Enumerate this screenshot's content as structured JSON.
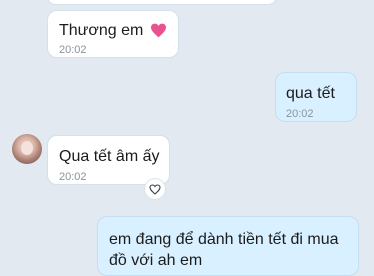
{
  "messages": [
    {
      "text": "",
      "time": ""
    },
    {
      "text": "Thương em",
      "time": "20:02",
      "emoji": "heart"
    },
    {
      "text": "qua tết",
      "time": "20:02"
    },
    {
      "text": "Qua tết âm ấy",
      "time": "20:02"
    },
    {
      "text": "em đang để dành tiền tết đi mua\nđồ với ah em",
      "time": ""
    }
  ],
  "icons": {
    "inline_emoji": "heart-icon",
    "reaction": "heart-outline-icon"
  },
  "colors": {
    "background": "#e2e9f1",
    "incoming_bubble": "#ffffff",
    "outgoing_bubble": "#d8f0ff",
    "heart": "#e8528f"
  }
}
